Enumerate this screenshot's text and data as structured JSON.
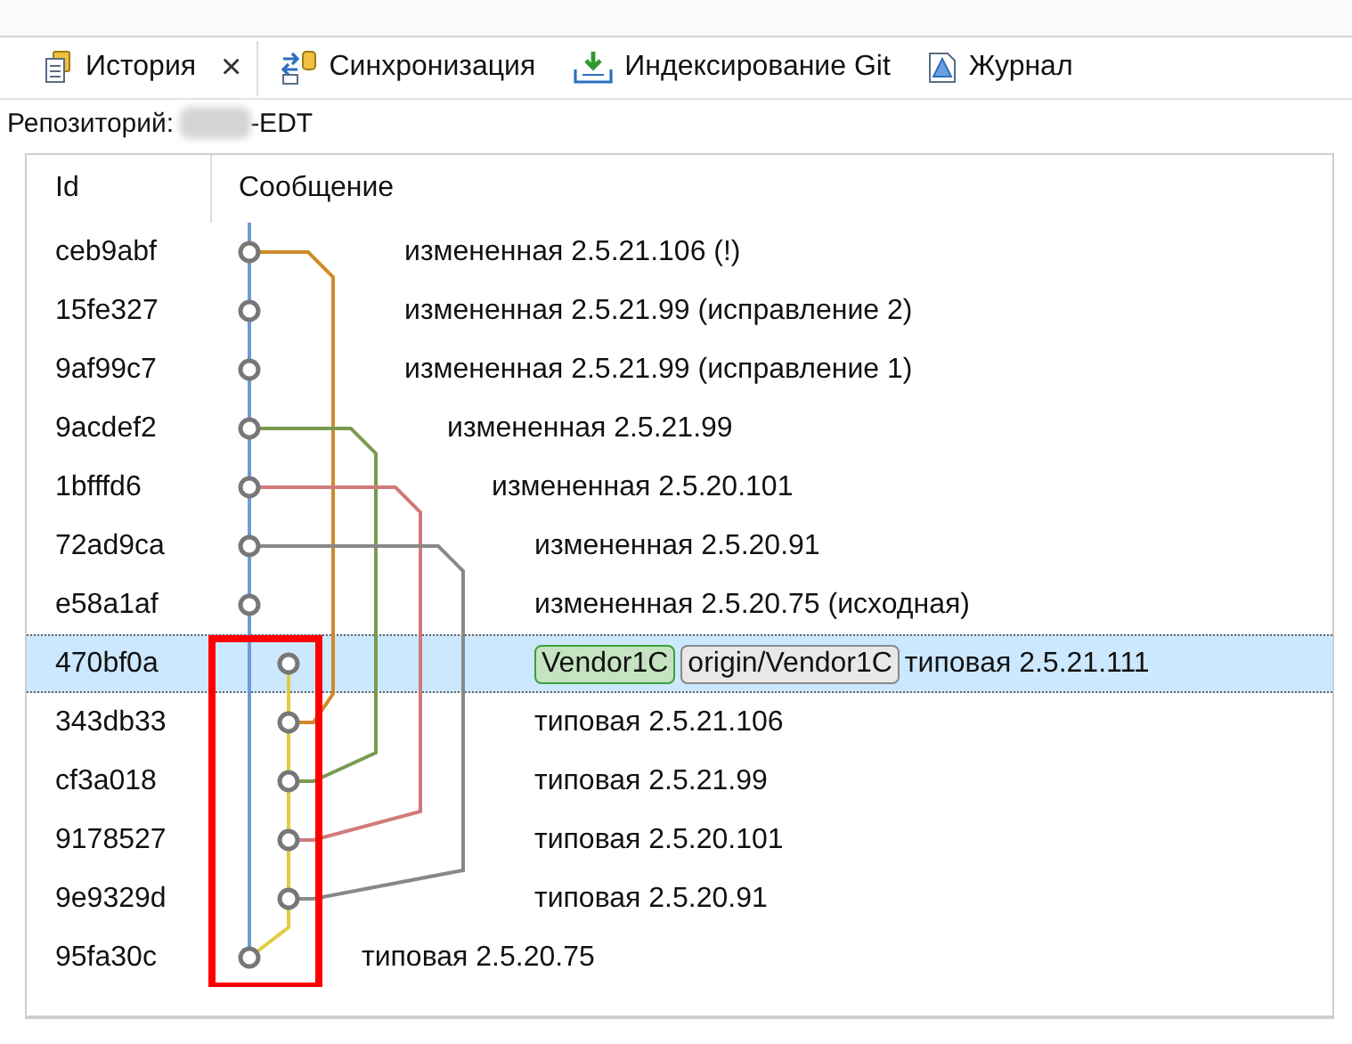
{
  "tabs": [
    {
      "label": "История",
      "selected": true,
      "closable": true,
      "kind": "history"
    },
    {
      "label": "Синхронизация",
      "selected": false,
      "closable": false,
      "kind": "sync"
    },
    {
      "label": "Индексирование Git",
      "selected": false,
      "closable": false,
      "kind": "staging"
    },
    {
      "label": "Журнал",
      "selected": false,
      "closable": false,
      "kind": "log"
    }
  ],
  "close_glyph": "×",
  "repository": {
    "label": "Репозиторий:",
    "value": "-EDT"
  },
  "table": {
    "columns": [
      "Id",
      "Сообщение"
    ],
    "rows": [
      {
        "id": "ceb9abf",
        "message": "измененная 2.5.21.106 (!)",
        "selected": false,
        "refs": []
      },
      {
        "id": "15fe327",
        "message": "измененная 2.5.21.99 (исправление 2)",
        "selected": false,
        "refs": []
      },
      {
        "id": "9af99c7",
        "message": "измененная 2.5.21.99 (исправление 1)",
        "selected": false,
        "refs": []
      },
      {
        "id": "9acdef2",
        "message": "измененная 2.5.21.99",
        "selected": false,
        "refs": []
      },
      {
        "id": "1bfffd6",
        "message": "измененная 2.5.20.101",
        "selected": false,
        "refs": []
      },
      {
        "id": "72ad9ca",
        "message": "измененная 2.5.20.91",
        "selected": false,
        "refs": []
      },
      {
        "id": "e58a1af",
        "message": "измененная 2.5.20.75 (исходная)",
        "selected": false,
        "refs": []
      },
      {
        "id": "470bf0a",
        "message": "типовая 2.5.21.111",
        "selected": true,
        "refs": [
          {
            "label": "Vendor1C",
            "kind": "local"
          },
          {
            "label": "origin/Vendor1C",
            "kind": "remote"
          }
        ]
      },
      {
        "id": "343db33",
        "message": "типовая 2.5.21.106",
        "selected": false,
        "refs": []
      },
      {
        "id": "cf3a018",
        "message": "типовая 2.5.21.99",
        "selected": false,
        "refs": []
      },
      {
        "id": "9178527",
        "message": "типовая 2.5.20.101",
        "selected": false,
        "refs": []
      },
      {
        "id": "9e9329d",
        "message": "типовая 2.5.20.91",
        "selected": false,
        "refs": []
      },
      {
        "id": "95fa30c",
        "message": "типовая 2.5.20.75",
        "selected": false,
        "refs": []
      }
    ]
  }
}
